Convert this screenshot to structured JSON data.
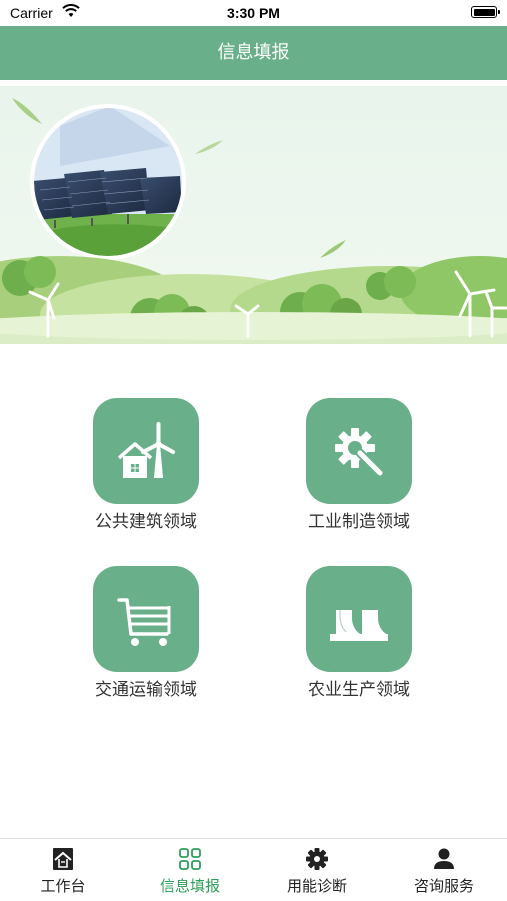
{
  "status_bar": {
    "carrier": "Carrier",
    "time": "3:30 PM"
  },
  "nav": {
    "title": "信息填报"
  },
  "grid": {
    "items": [
      {
        "label": "公共建筑领域",
        "icon": "house-windmill-icon"
      },
      {
        "label": "工业制造领域",
        "icon": "gear-wrench-icon"
      },
      {
        "label": "交通运输领域",
        "icon": "cart-icon"
      },
      {
        "label": "农业生产领域",
        "icon": "greenhouse-icon"
      }
    ]
  },
  "tabs": [
    {
      "label": "工作台",
      "icon": "workbench-icon",
      "active": false
    },
    {
      "label": "信息填报",
      "icon": "grid-icon",
      "active": true
    },
    {
      "label": "用能诊断",
      "icon": "gear-icon",
      "active": false
    },
    {
      "label": "咨询服务",
      "icon": "person-icon",
      "active": false
    }
  ],
  "colors": {
    "brand": "#69b08a",
    "active_tab": "#2e9e5a"
  }
}
